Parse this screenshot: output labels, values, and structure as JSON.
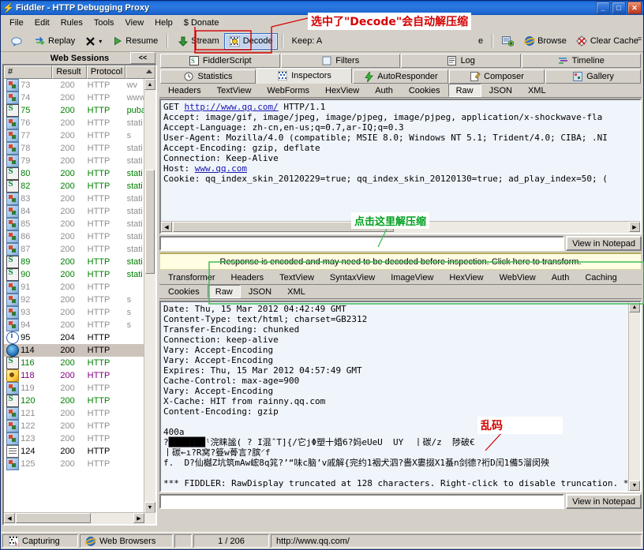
{
  "window": {
    "title": "Fiddler - HTTP Debugging Proxy",
    "logo_icon": "lightning-icon",
    "minimize_label": "_",
    "maximize_label": "□",
    "close_label": "✕"
  },
  "menu": {
    "items": [
      {
        "label": "File"
      },
      {
        "label": "Edit"
      },
      {
        "label": "Rules"
      },
      {
        "label": "Tools"
      },
      {
        "label": "View"
      },
      {
        "label": "Help"
      },
      {
        "label": "$ Donate"
      }
    ]
  },
  "toolbar": {
    "comment_label": "",
    "comment_icon": "speech-bubble-icon",
    "replay_label": "Replay",
    "replay_icon": "replay-arrows-icon",
    "remove_label": "",
    "remove_icon": "x-icon",
    "remove_dropdown": "▾",
    "resume_label": "Resume",
    "resume_icon": "play-triangle-icon",
    "stream_label": "Stream",
    "stream_icon": "green-down-arrow-icon",
    "decode_label": "Decode",
    "decode_icon": "decode-grid-icon",
    "keep_label": "Keep: A",
    "anyprocess_label": "e",
    "findsession_icon": "find-session-icon",
    "browse_label": "Browse",
    "browse_icon": "internet-explorer-icon",
    "clearcache_label": "Clear Cache",
    "clearcache_icon": "clear-cache-icon",
    "overflow_label": "≡"
  },
  "sessions": {
    "panel_title": "Web Sessions",
    "collapse_label": "<<",
    "columns": [
      "#",
      "Result",
      "Protocol",
      ""
    ],
    "sort_arrow": "sort-ascending-icon",
    "rows": [
      {
        "icon": "doc",
        "id": "73",
        "result": "200",
        "protocol": "HTTP",
        "host": "wv",
        "color": "c-gray",
        "selected": false
      },
      {
        "icon": "doc",
        "id": "74",
        "result": "200",
        "protocol": "HTTP",
        "host": "www",
        "color": "c-gray",
        "selected": false
      },
      {
        "icon": "script",
        "id": "75",
        "result": "200",
        "protocol": "HTTP",
        "host": "puba",
        "color": "c-green",
        "selected": false
      },
      {
        "icon": "doc",
        "id": "76",
        "result": "200",
        "protocol": "HTTP",
        "host": "stati",
        "color": "c-gray",
        "selected": false
      },
      {
        "icon": "doc",
        "id": "77",
        "result": "200",
        "protocol": "HTTP",
        "host": "s",
        "color": "c-gray",
        "selected": false
      },
      {
        "icon": "doc",
        "id": "78",
        "result": "200",
        "protocol": "HTTP",
        "host": "stati",
        "color": "c-gray",
        "selected": false
      },
      {
        "icon": "doc",
        "id": "79",
        "result": "200",
        "protocol": "HTTP",
        "host": "stati",
        "color": "c-gray",
        "selected": false
      },
      {
        "icon": "script",
        "id": "80",
        "result": "200",
        "protocol": "HTTP",
        "host": "stati",
        "color": "c-green",
        "selected": false
      },
      {
        "icon": "script",
        "id": "82",
        "result": "200",
        "protocol": "HTTP",
        "host": "stati",
        "color": "c-green",
        "selected": false
      },
      {
        "icon": "doc",
        "id": "83",
        "result": "200",
        "protocol": "HTTP",
        "host": "stati",
        "color": "c-gray",
        "selected": false
      },
      {
        "icon": "doc",
        "id": "84",
        "result": "200",
        "protocol": "HTTP",
        "host": "stati",
        "color": "c-gray",
        "selected": false
      },
      {
        "icon": "doc",
        "id": "85",
        "result": "200",
        "protocol": "HTTP",
        "host": "stati",
        "color": "c-gray",
        "selected": false
      },
      {
        "icon": "doc",
        "id": "86",
        "result": "200",
        "protocol": "HTTP",
        "host": "stati",
        "color": "c-gray",
        "selected": false
      },
      {
        "icon": "doc",
        "id": "87",
        "result": "200",
        "protocol": "HTTP",
        "host": "stati",
        "color": "c-gray",
        "selected": false
      },
      {
        "icon": "script",
        "id": "89",
        "result": "200",
        "protocol": "HTTP",
        "host": "stati",
        "color": "c-green",
        "selected": false
      },
      {
        "icon": "script",
        "id": "90",
        "result": "200",
        "protocol": "HTTP",
        "host": "stati",
        "color": "c-green",
        "selected": false
      },
      {
        "icon": "doc",
        "id": "91",
        "result": "200",
        "protocol": "HTTP",
        "host": "",
        "color": "c-gray",
        "selected": false
      },
      {
        "icon": "doc",
        "id": "92",
        "result": "200",
        "protocol": "HTTP",
        "host": "s",
        "color": "c-gray",
        "selected": false
      },
      {
        "icon": "doc",
        "id": "93",
        "result": "200",
        "protocol": "HTTP",
        "host": "s",
        "color": "c-gray",
        "selected": false
      },
      {
        "icon": "doc",
        "id": "94",
        "result": "200",
        "protocol": "HTTP",
        "host": "s",
        "color": "c-gray",
        "selected": false
      },
      {
        "icon": "info",
        "id": "95",
        "result": "204",
        "protocol": "HTTP",
        "host": "",
        "color": "c-black",
        "selected": false
      },
      {
        "icon": "globe",
        "id": "114",
        "result": "200",
        "protocol": "HTTP",
        "host": "",
        "color": "c-black",
        "selected": true
      },
      {
        "icon": "script",
        "id": "116",
        "result": "200",
        "protocol": "HTTP",
        "host": "",
        "color": "c-green",
        "selected": false
      },
      {
        "icon": "flash",
        "id": "118",
        "result": "200",
        "protocol": "HTTP",
        "host": "",
        "color": "c-purple",
        "selected": false
      },
      {
        "icon": "doc",
        "id": "119",
        "result": "200",
        "protocol": "HTTP",
        "host": "",
        "color": "c-gray",
        "selected": false
      },
      {
        "icon": "script",
        "id": "120",
        "result": "200",
        "protocol": "HTTP",
        "host": "",
        "color": "c-green",
        "selected": false
      },
      {
        "icon": "doc",
        "id": "121",
        "result": "200",
        "protocol": "HTTP",
        "host": "",
        "color": "c-gray",
        "selected": false
      },
      {
        "icon": "doc",
        "id": "122",
        "result": "200",
        "protocol": "HTTP",
        "host": "",
        "color": "c-gray",
        "selected": false
      },
      {
        "icon": "doc",
        "id": "123",
        "result": "200",
        "protocol": "HTTP",
        "host": "",
        "color": "c-gray",
        "selected": false
      },
      {
        "icon": "text",
        "id": "124",
        "result": "200",
        "protocol": "HTTP",
        "host": "",
        "color": "c-black",
        "selected": false
      },
      {
        "icon": "doc",
        "id": "125",
        "result": "200",
        "protocol": "HTTP",
        "host": "",
        "color": "c-gray",
        "selected": false
      }
    ]
  },
  "top_tabs_upper": [
    {
      "label": "FiddlerScript",
      "icon": "script-icon"
    },
    {
      "label": "Filters",
      "icon": "filter-icon"
    },
    {
      "label": "Log",
      "icon": "log-icon"
    },
    {
      "label": "Timeline",
      "icon": "timeline-icon"
    }
  ],
  "top_tabs_lower": [
    {
      "label": "Statistics",
      "icon": "clock-icon",
      "active": false
    },
    {
      "label": "Inspectors",
      "icon": "inspectors-icon",
      "active": true
    },
    {
      "label": "AutoResponder",
      "icon": "bolt-icon",
      "active": false
    },
    {
      "label": "Composer",
      "icon": "composer-icon",
      "active": false
    },
    {
      "label": "Gallery",
      "icon": "gallery-icon",
      "active": false
    }
  ],
  "request_tabs": [
    {
      "label": "Headers",
      "active": false
    },
    {
      "label": "TextView",
      "active": false
    },
    {
      "label": "WebForms",
      "active": false
    },
    {
      "label": "HexView",
      "active": false
    },
    {
      "label": "Auth",
      "active": false
    },
    {
      "label": "Cookies",
      "active": false
    },
    {
      "label": "Raw",
      "active": true
    },
    {
      "label": "JSON",
      "active": false
    },
    {
      "label": "XML",
      "active": false
    }
  ],
  "request_raw": {
    "line1_method": "GET ",
    "line1_url": "http://www.qq.com/",
    "line1_version": " HTTP/1.1",
    "rest": "Accept: image/gif, image/jpeg, image/pjpeg, image/pjpeg, application/x-shockwave-fla\nAccept-Language: zh-cn,en-us;q=0.7,ar-IQ;q=0.3\nUser-Agent: Mozilla/4.0 (compatible; MSIE 8.0; Windows NT 5.1; Trident/4.0; CIBA; .NI\nAccept-Encoding: gzip, deflate\nConnection: Keep-Alive\nHost: ",
    "host_value": "www.qq.com",
    "cookie_line": "\nCookie: qq_index_skin_20120229=true; qq_index_skin_20120130=true; ad_play_index=50; ("
  },
  "request_find": {
    "value": "",
    "placeholder": "",
    "notepad_button": "View in Notepad"
  },
  "notice": {
    "text": "Response is encoded and may need to be decoded before inspection. Click here to transform."
  },
  "response_tabs_row1": [
    {
      "label": "Transformer",
      "active": false
    },
    {
      "label": "Headers",
      "active": false
    },
    {
      "label": "TextView",
      "active": false
    },
    {
      "label": "SyntaxView",
      "active": false
    },
    {
      "label": "ImageView",
      "active": false
    },
    {
      "label": "HexView",
      "active": false
    },
    {
      "label": "WebView",
      "active": false
    },
    {
      "label": "Auth",
      "active": false
    },
    {
      "label": "Caching",
      "active": false
    }
  ],
  "response_tabs_row2": [
    {
      "label": "Cookies",
      "active": false
    },
    {
      "label": "Raw",
      "active": true
    },
    {
      "label": "JSON",
      "active": false
    },
    {
      "label": "XML",
      "active": false
    }
  ],
  "response_raw": {
    "text": "Date: Thu, 15 Mar 2012 04:42:49 GMT\nContent-Type: text/html; charset=GB2312\nTransfer-Encoding: chunked\nConnection: keep-alive\nVary: Accept-Encoding\nVary: Accept-Encoding\nExpires: Thu, 15 Mar 2012 04:57:49 GMT\nCache-Control: max-age=900\nVary: Accept-Encoding\nX-Cache: HIT from rainny.qq.com\nContent-Encoding: gzip\n\n400a\n?███████ˡ浣睐謐( ? I混ˆT]{/它jΦ塑十婚6?妈eUeU  UY  丨碳/z  陟破€\n丨碳←ı?R窝?簦w蓇言?膑⸍f\nf.  D?仙樾Z坑筑mAw峵8q筄?’“味c脑’v戚解{完约1裀犬泗?嗇X婁掇X1蜝n剑德?裄D闰1備5溜闵殃\n\n*** FIDDLER: RawDisplay truncated at 128 characters. Right-click to disable truncation. ***"
  },
  "response_find": {
    "value": "",
    "placeholder": "",
    "notepad_button": "View in Notepad"
  },
  "statusbar": {
    "capturing_label": "Capturing",
    "capturing_icon": "capturing-icon",
    "process_label": "Web Browsers",
    "process_icon": "internet-explorer-icon",
    "blank_cell": "",
    "count_label": "1 / 206",
    "url_label": "http://www.qq.com/"
  },
  "annotations": [
    {
      "id": "decode-note",
      "text": "选中了\"Decode\"会自动解压缩",
      "color": "red"
    },
    {
      "id": "click-here-note",
      "text": "点击这里解压缩",
      "color": "green"
    },
    {
      "id": "garbled-note",
      "text": "乱码",
      "color": "red"
    }
  ],
  "colors": {
    "accent_blue": "#0a57c6",
    "annotation_red": "#d40000",
    "annotation_green": "#00a020",
    "notice_bg": "#fffde2",
    "selection": "#ccc4bc"
  }
}
